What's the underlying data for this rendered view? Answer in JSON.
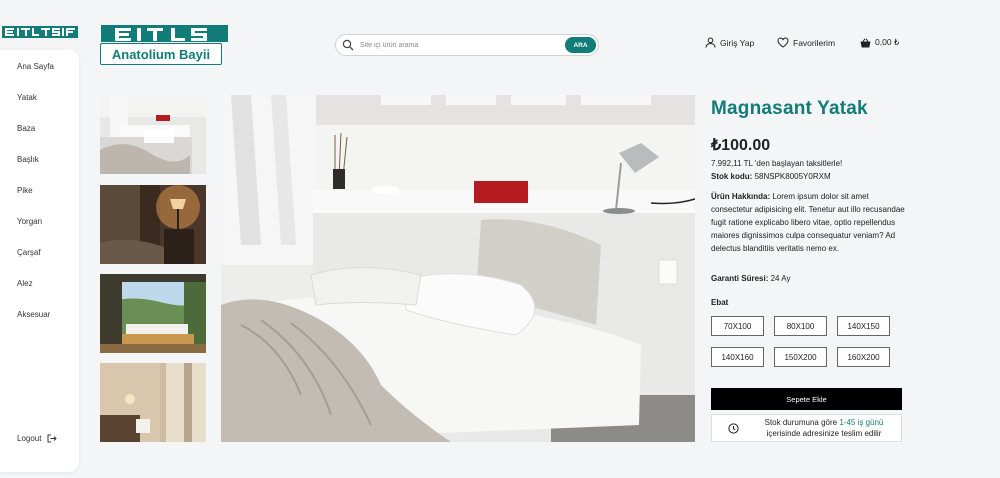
{
  "sidebar": {
    "items": [
      {
        "label": "Ana Sayfa"
      },
      {
        "label": "Yatak"
      },
      {
        "label": "Baza"
      },
      {
        "label": "Başlık"
      },
      {
        "label": "Pike"
      },
      {
        "label": "Yorgan"
      },
      {
        "label": "Çarşaf"
      },
      {
        "label": "Alez"
      },
      {
        "label": "Aksesuar"
      }
    ],
    "logout_label": "Logout"
  },
  "brand": {
    "name": "Anatolium Bayii",
    "color": "#127c78"
  },
  "search": {
    "placeholder": "Site içi ürün arama",
    "button_label": "ARA"
  },
  "topnav": {
    "login_label": "Giriş Yap",
    "favorites_label": "Favorilerim",
    "cart_label": "0,00 ₺"
  },
  "product": {
    "title": "Magnasant Yatak",
    "price": "₺100.00",
    "installment": "7.992,11 TL 'den başlayan taksitlerle!",
    "stock_label": "Stok kodu:",
    "stock_code": "58NSPK8005Y0RXM",
    "about_label": "Ürün Hakkında:",
    "about_text": "Lorem ipsum dolor sit amet consectetur adipisicing elit. Tenetur aut illo recusandae fugit ratione explicabo libero vitae, optio repellendus maiores dignissimos culpa consequatur veniam? Ad delectus blanditiis veritatis nemo ex.",
    "warranty_label": "Garanti Süresi:",
    "warranty_value": "24 Ay",
    "size_label": "Ebat",
    "sizes": [
      "70X100",
      "80X100",
      "140X150",
      "140X160",
      "150X200",
      "160X200"
    ],
    "add_to_cart_label": "Sepete Ekle",
    "delivery_prefix": "Stok durumuna göre",
    "delivery_days": "1-45 iş günü",
    "delivery_suffix": "içerisinde adresinize teslim edilir"
  }
}
